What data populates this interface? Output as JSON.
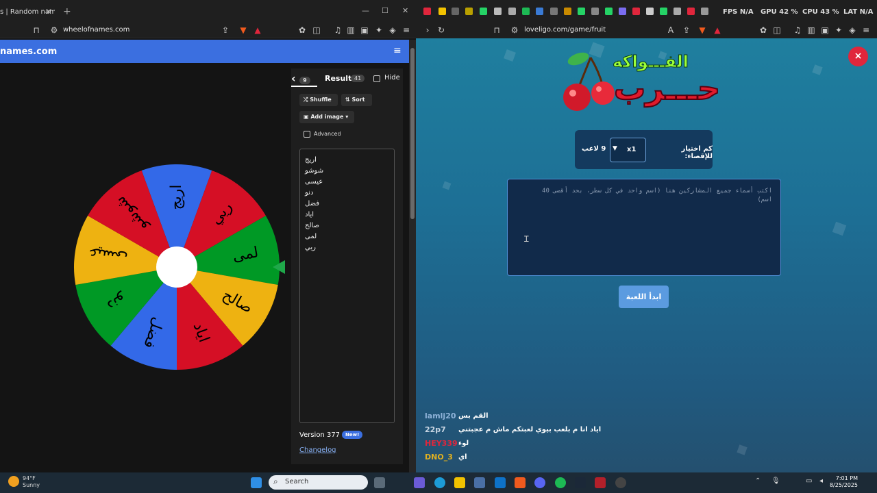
{
  "left_browser": {
    "tab_title": "s | Random nam",
    "url": "wheelofnames.com",
    "brand": "names.com",
    "entries_count": "9",
    "results_label": "Results",
    "results_count": "41",
    "hide_label": "Hide",
    "shuffle_label": "Shuffle",
    "sort_label": "Sort",
    "add_image_label": "Add image",
    "advanced_label": "Advanced",
    "names": [
      "اريج",
      "شوشو",
      "عيسى",
      "دنو",
      "فضل",
      "اياد",
      "صالح",
      "لمى",
      "ريي"
    ],
    "version": "Version 377",
    "new_badge": "New!",
    "changelog": "Changelog",
    "wheel": {
      "segments": [
        {
          "label": "اريج",
          "color": "#3369e8"
        },
        {
          "label": "ريي",
          "color": "#d50f25"
        },
        {
          "label": "لمى",
          "color": "#009925"
        },
        {
          "label": "صالح",
          "color": "#eeb211"
        },
        {
          "label": "اياد",
          "color": "#d50f25"
        },
        {
          "label": "فضل",
          "color": "#3369e8"
        },
        {
          "label": "دنو",
          "color": "#009925"
        },
        {
          "label": "عيسى",
          "color": "#eeb211"
        },
        {
          "label": "شوشو",
          "color": "#d50f25"
        }
      ]
    }
  },
  "right_browser": {
    "url": "loveligo.com/game/fruit",
    "fps_label": "FPS",
    "fps_value": "N/A",
    "gpu_label": "GPU",
    "gpu_value": "42 %",
    "cpu_label": "CPU",
    "cpu_value": "43 %",
    "lat_label": "LAT",
    "lat_value": "N/A",
    "logo_top": "الفـــواكه",
    "logo_bottom": "حـــرب",
    "elimination_label": "كم اختيار للإقصاء:",
    "select_value": "x1",
    "players_label": "9 لاعب",
    "textarea_placeholder": "اكتب أسماء جميع المشاركين هنا (اسم واحد في كل سطر، بحد أقصى 40 اسم)",
    "start_button": "ابدأ اللعبة",
    "close_icon": "×",
    "chat": [
      {
        "user": "lamlj20",
        "text": "القم بس",
        "color": "#8fb3d9"
      },
      {
        "user": "22p7",
        "text": "اياد انا م بلعب بيوي لعبتكم ماش م عجبتني",
        "color": "#c9d6e3"
      },
      {
        "user": "HEY339",
        "text": "لوء",
        "color": "#e0263c"
      },
      {
        "user": "DNO_3",
        "text": "اي",
        "color": "#e0b020"
      }
    ]
  },
  "taskbar": {
    "weather_temp": "94°F",
    "weather_desc": "Sunny",
    "search_label": "Search",
    "time": "7:01 PM",
    "date": "8/25/2025"
  }
}
